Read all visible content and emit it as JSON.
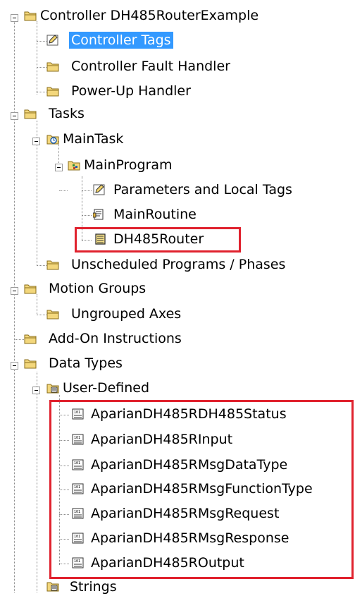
{
  "tree": {
    "controller": {
      "label": "Controller DH485RouterExample"
    },
    "controller_tags": {
      "label": "Controller Tags"
    },
    "controller_fault_handler": {
      "label": "Controller Fault Handler"
    },
    "power_up_handler": {
      "label": "Power-Up Handler"
    },
    "tasks": {
      "label": "Tasks"
    },
    "main_task": {
      "label": "MainTask"
    },
    "main_program": {
      "label": "MainProgram"
    },
    "parameters_local_tags": {
      "label": "Parameters and Local Tags"
    },
    "main_routine": {
      "label": "MainRoutine"
    },
    "dh485_router": {
      "label": "DH485Router"
    },
    "unscheduled_programs": {
      "label": "Unscheduled Programs / Phases"
    },
    "motion_groups": {
      "label": "Motion Groups"
    },
    "ungrouped_axes": {
      "label": "Ungrouped Axes"
    },
    "add_on_instructions": {
      "label": "Add-On Instructions"
    },
    "data_types": {
      "label": "Data Types"
    },
    "user_defined": {
      "label": "User-Defined"
    },
    "udt": [
      {
        "label": "AparianDH485RDH485Status"
      },
      {
        "label": "AparianDH485RInput"
      },
      {
        "label": "AparianDH485RMsgDataType"
      },
      {
        "label": "AparianDH485RMsgFunctionType"
      },
      {
        "label": "AparianDH485RMsgRequest"
      },
      {
        "label": "AparianDH485RMsgResponse"
      },
      {
        "label": "AparianDH485ROutput"
      }
    ],
    "strings": {
      "label": "Strings"
    }
  },
  "colors": {
    "selection": "#3399ff",
    "highlight_box": "#e0222e",
    "folder": "#f3d77c"
  },
  "icons": [
    "collapse-icon",
    "folder-icon",
    "tags-icon",
    "task-icon",
    "program-icon",
    "routine-icon",
    "ladder-icon",
    "datatype-icon"
  ]
}
